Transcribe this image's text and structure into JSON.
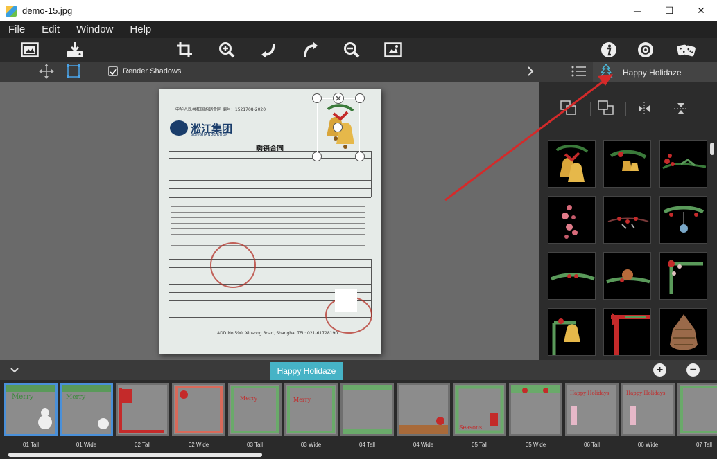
{
  "window": {
    "title": "demo-15.jpg",
    "minimize_glyph": "─",
    "maximize_glyph": "☐",
    "close_glyph": "✕"
  },
  "menu": [
    "File",
    "Edit",
    "Window",
    "Help"
  ],
  "toolbar": {
    "icons": [
      "open-image-icon",
      "save-download-icon",
      "crop-icon",
      "zoom-in-icon",
      "undo-icon",
      "redo-icon",
      "zoom-out-icon",
      "fit-image-icon",
      "info-icon",
      "settings-icon",
      "dice-icon"
    ]
  },
  "subbar": {
    "render_shadows_label": "Render Shadows",
    "render_shadows_checked": true
  },
  "panel": {
    "title": "Happy Holidaze",
    "tools": [
      "send-backward-icon",
      "bring-forward-icon",
      "flip-horizontal-icon",
      "flip-vertical-icon"
    ]
  },
  "document": {
    "company": "淞江集团",
    "company_en": "SONGJIANGGROUP",
    "title": "购销合同",
    "header_line": "中华人民共和国购销合同 编号：1521708-2020",
    "footer_line": "ADD:No.590, Xinsong Road, Shanghai TEL: 021-61728190"
  },
  "strip": {
    "tab_label": "Happy Holidaze",
    "add_glyph": "+",
    "remove_glyph": "−",
    "collapse_glyph": "⌄",
    "frames": [
      {
        "label": "01 Tall",
        "selected": true
      },
      {
        "label": "01 Wide",
        "selected": true
      },
      {
        "label": "02 Tall",
        "selected": false
      },
      {
        "label": "02 Wide",
        "selected": false
      },
      {
        "label": "03 Tall",
        "selected": false
      },
      {
        "label": "03 Wide",
        "selected": false
      },
      {
        "label": "04 Tall",
        "selected": false
      },
      {
        "label": "04 Wide",
        "selected": false
      },
      {
        "label": "05 Tall",
        "selected": false
      },
      {
        "label": "05 Wide",
        "selected": false
      },
      {
        "label": "06 Tall",
        "selected": false
      },
      {
        "label": "06 Wide",
        "selected": false
      },
      {
        "label": "07 Tall",
        "selected": false
      }
    ]
  },
  "colors": {
    "accent": "#46b3c6",
    "selection": "#4a90d9",
    "annotation_arrow": "#d42a2a"
  }
}
